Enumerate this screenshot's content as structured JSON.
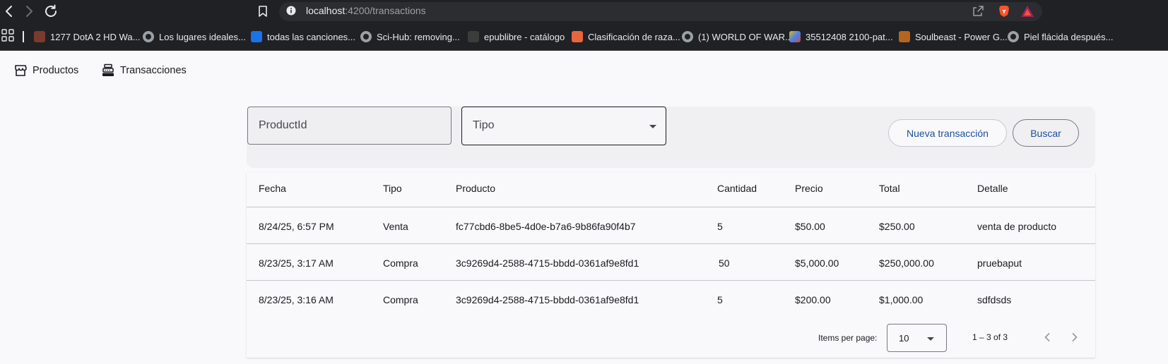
{
  "browser": {
    "url_host": "localhost",
    "url_path": ":4200/transactions",
    "bookmarks": [
      {
        "label": "1277 DotA 2 HD Wa...",
        "favicon": "dota-favicon"
      },
      {
        "label": "Los lugares ideales...",
        "favicon": "globe-favicon"
      },
      {
        "label": "todas las canciones...",
        "favicon": "tt-favicon"
      },
      {
        "label": "Sci-Hub: removing...",
        "favicon": "globe-favicon"
      },
      {
        "label": "epublibre - catálogo",
        "favicon": "epublibre-favicon"
      },
      {
        "label": "Clasificación de raza...",
        "favicon": "orange-favicon"
      },
      {
        "label": "(1) WORLD OF WAR...",
        "favicon": "globe-favicon"
      },
      {
        "label": "35512408 2100-pat...",
        "favicon": "multicolor-favicon"
      },
      {
        "label": "Soulbeast - Power G...",
        "favicon": "gw2-favicon"
      },
      {
        "label": "Piel flácida después...",
        "favicon": "globe-favicon"
      }
    ]
  },
  "app_nav": {
    "productos": "Productos",
    "transacciones": "Transacciones"
  },
  "filters": {
    "product_id_placeholder": "ProductId",
    "tipo_label": "Tipo",
    "new_transaction": "Nueva transacción",
    "search": "Buscar"
  },
  "table": {
    "headers": [
      "Fecha",
      "Tipo",
      "Producto",
      "Cantidad",
      "Precio",
      "Total",
      "Detalle"
    ],
    "rows": [
      [
        "8/24/25, 6:57 PM",
        "Venta",
        "fc77cbd6-8be5-4d0e-b7a6-9b86fa90f4b7",
        "5",
        "$50.00",
        "$250.00",
        "venta de producto"
      ],
      [
        "8/23/25, 3:17 AM",
        "Compra",
        "3c9269d4-2588-4715-bbdd-0361af9e8fd1",
        "50",
        "$5,000.00",
        "$250,000.00",
        "pruebaput"
      ],
      [
        "8/23/25, 3:16 AM",
        "Compra",
        "3c9269d4-2588-4715-bbdd-0361af9e8fd1",
        "5",
        "$200.00",
        "$1,000.00",
        "sdfdsds"
      ]
    ]
  },
  "paginator": {
    "items_per_page_label": "Items per page:",
    "page_size": "10",
    "range": "1 – 3 of 3"
  },
  "colors": {
    "chrome_bg": "#202124",
    "page_bg": "#f9f9fc",
    "primary_text_button": "#1d4d9b"
  }
}
